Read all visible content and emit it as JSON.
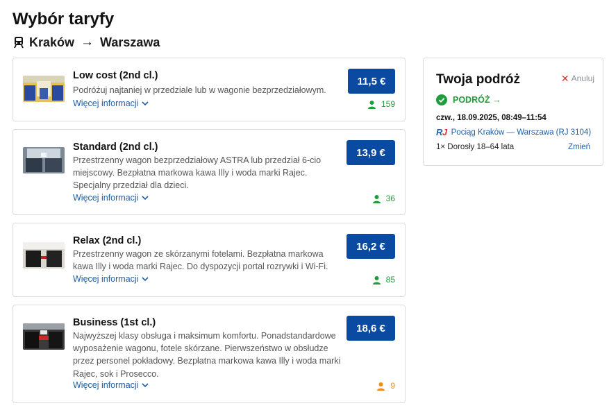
{
  "header": {
    "title": "Wybór taryfy",
    "route_from": "Kraków",
    "route_arrow": "→",
    "route_to": "Warszawa"
  },
  "fares": [
    {
      "name": "Low cost (2nd cl.)",
      "description": "Podróżuj najtaniej w przedziale lub w wagonie bezprzedziałowym.",
      "more_info": "Więcej informacji",
      "price": "11,5 €",
      "seats": "159",
      "seats_color": "#1f9d3c"
    },
    {
      "name": "Standard (2nd cl.)",
      "description": "Przestrzenny wagon bezprzedziałowy ASTRA lub przedział 6-cio miejscowy. Bezpłatna markowa kawa Illy i woda marki Rajec. Specjalny przedział dla dzieci.",
      "more_info": "Więcej informacji",
      "price": "13,9 €",
      "seats": "36",
      "seats_color": "#1f9d3c"
    },
    {
      "name": "Relax (2nd cl.)",
      "description": "Przestrzenny wagon ze skórzanymi fotelami. Bezpłatna markowa kawa Illy i woda marki Rajec. Do dyspozycji portal rozrywki i Wi-Fi.",
      "more_info": "Więcej informacji",
      "price": "16,2 €",
      "seats": "85",
      "seats_color": "#1f9d3c"
    },
    {
      "name": "Business (1st cl.)",
      "description": "Najwyższej klasy obsługa i maksimum komfortu. Ponadstandardowe wyposażenie wagonu, fotele skórzane. Pierwszeństwo w obsłudze przez personel pokładowy. Bezpłatna markowa kawa Illy i woda marki Rajec, sok i Prosecco.",
      "more_info": "Więcej informacji",
      "price": "18,6 €",
      "seats": "9",
      "seats_color": "#f08c1a"
    }
  ],
  "summary": {
    "title": "Twoja podróż",
    "cancel": "Anuluj",
    "direction": "PODRÓŻ →",
    "datetime": "czw., 18.09.2025, 08:49–11:54",
    "rj_r": "R",
    "rj_j": "J",
    "train": "Pociąg Kraków — Warszawa (RJ 3104)",
    "passengers": "1× Dorosły 18–64 lata",
    "change": "Zmień"
  },
  "colors": {
    "primary": "#0a4aa0",
    "link": "#1f5fa8",
    "success": "#1f9d3c",
    "warning": "#f08c1a",
    "danger": "#e03030"
  },
  "icons": {
    "route": "train-icon",
    "more": "chevron-down-icon",
    "seats": "person-icon",
    "direction": "check-circle-icon",
    "cancel": "close-icon"
  }
}
